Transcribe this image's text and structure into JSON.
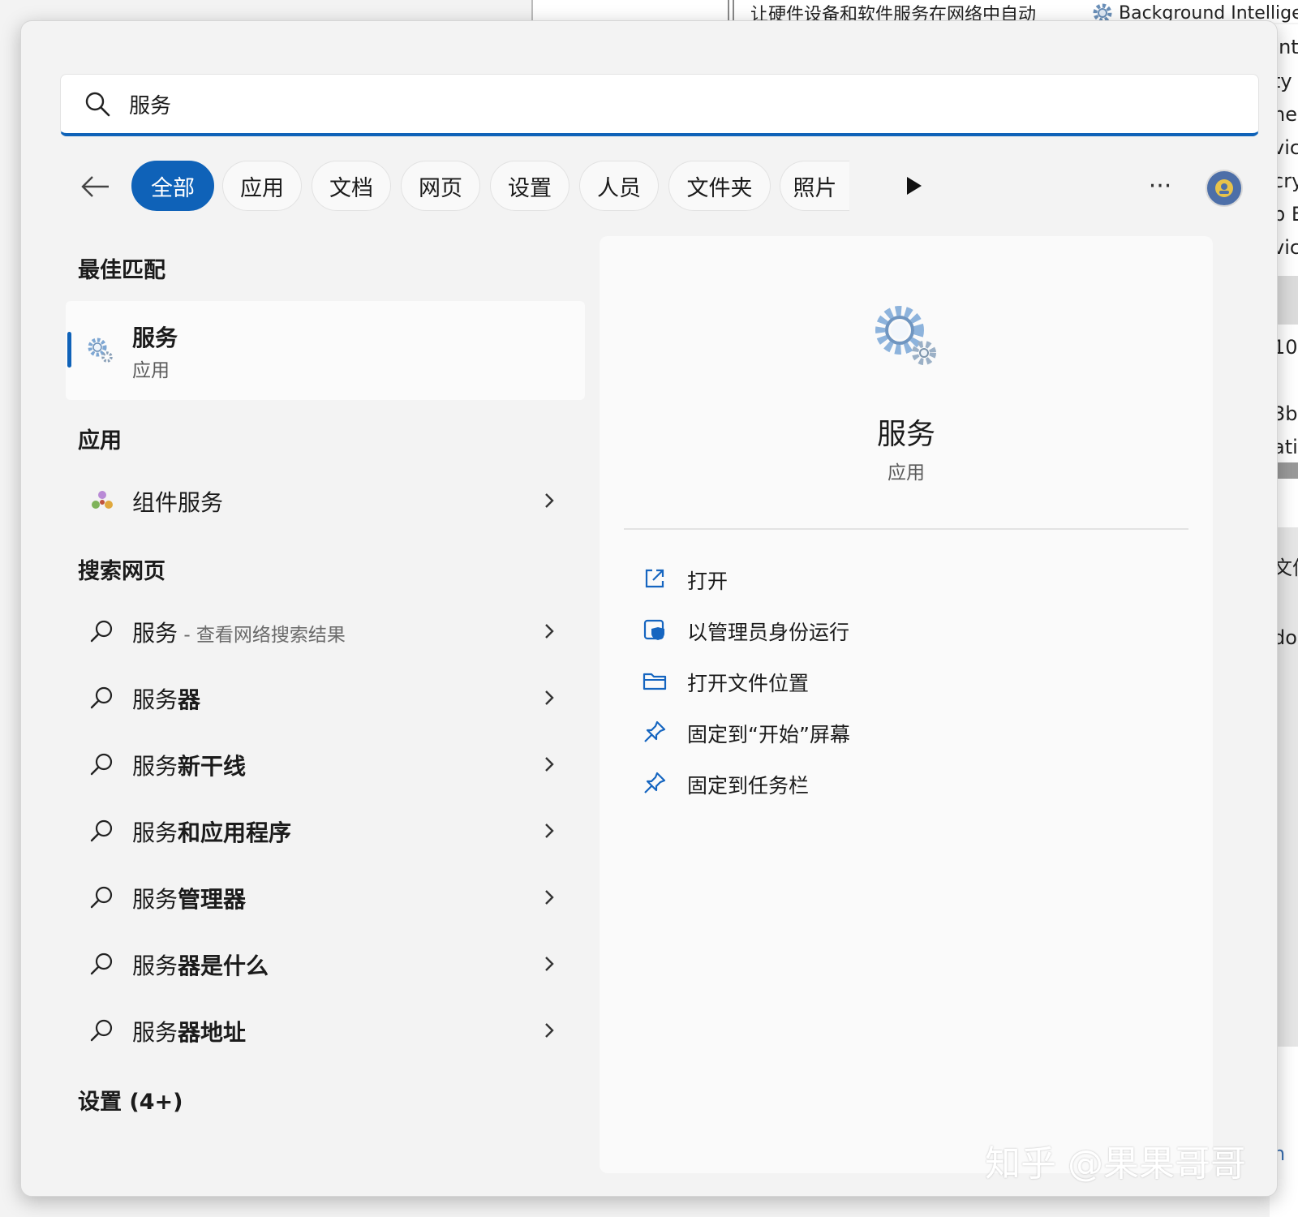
{
  "background_window": {
    "top_description": "让硬件设备和软件服务在网络中自动",
    "top_service": "Background Intellige",
    "right_fragments": [
      "Int",
      "ty",
      "ne",
      "vic",
      "cry",
      "p E",
      "vic",
      "10",
      "3b",
      "ati",
      "文件",
      "do",
      "n"
    ]
  },
  "search": {
    "value": "服务",
    "placeholder": ""
  },
  "filters": {
    "chips": [
      "全部",
      "应用",
      "文档",
      "网页",
      "设置",
      "人员",
      "文件夹",
      "照片"
    ],
    "active_index": 0,
    "more_label": "···"
  },
  "best_match": {
    "heading": "最佳匹配",
    "name": "服务",
    "type": "应用"
  },
  "apps": {
    "heading": "应用",
    "items": [
      {
        "label": "组件服务"
      }
    ]
  },
  "web": {
    "heading": "搜索网页",
    "items": [
      {
        "prefix": "服务",
        "bold": "",
        "sub": " - 查看网络搜索结果"
      },
      {
        "prefix": "服务",
        "bold": "器",
        "sub": ""
      },
      {
        "prefix": "服务",
        "bold": "新干线",
        "sub": ""
      },
      {
        "prefix": "服务",
        "bold": "和应用程序",
        "sub": ""
      },
      {
        "prefix": "服务",
        "bold": "管理器",
        "sub": ""
      },
      {
        "prefix": "服务",
        "bold": "器是什么",
        "sub": ""
      },
      {
        "prefix": "服务",
        "bold": "器地址",
        "sub": ""
      }
    ]
  },
  "settings": {
    "heading": "设置 (4+)"
  },
  "preview": {
    "title": "服务",
    "subtitle": "应用",
    "actions": [
      {
        "label": "打开",
        "icon": "open-external-icon"
      },
      {
        "label": "以管理员身份运行",
        "icon": "shield-admin-icon"
      },
      {
        "label": "打开文件位置",
        "icon": "folder-icon"
      },
      {
        "label": "固定到“开始”屏幕",
        "icon": "pin-icon"
      },
      {
        "label": "固定到任务栏",
        "icon": "pin-icon"
      }
    ]
  },
  "watermark": "知乎 @果果哥哥",
  "colors": {
    "accent": "#0f62b8",
    "panel": "#f3f3f3",
    "preview": "#fafafa"
  }
}
